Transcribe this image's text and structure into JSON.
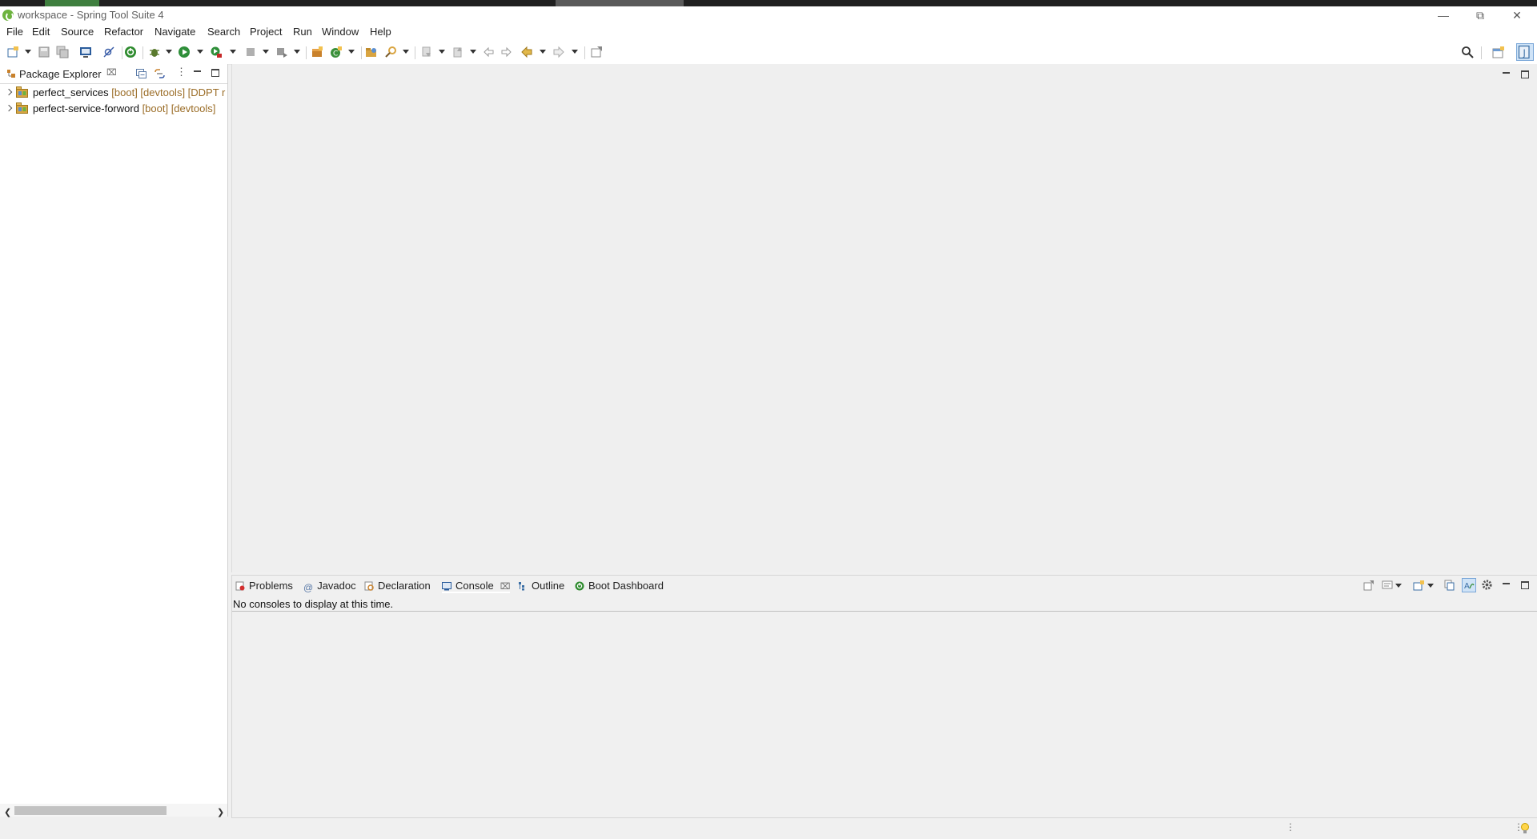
{
  "window": {
    "title": "workspace - Spring Tool Suite 4"
  },
  "menu": [
    "File",
    "Edit",
    "Source",
    "Refactor",
    "Navigate",
    "Search",
    "Project",
    "Run",
    "Window",
    "Help"
  ],
  "package_explorer": {
    "title": "Package Explorer",
    "projects": [
      {
        "name": "perfect_services",
        "decorations": "[boot] [devtools] [DDPT r"
      },
      {
        "name": "perfect-service-forword",
        "decorations": "[boot] [devtools]"
      }
    ]
  },
  "bottom_panel": {
    "tabs": [
      "Problems",
      "Javadoc",
      "Declaration",
      "Console",
      "Outline",
      "Boot Dashboard"
    ],
    "active_tab": "Console",
    "console_message": "No consoles to display at this time."
  },
  "colors": {
    "boot_green": "#6db33f",
    "decoration": "#9b6d27"
  }
}
